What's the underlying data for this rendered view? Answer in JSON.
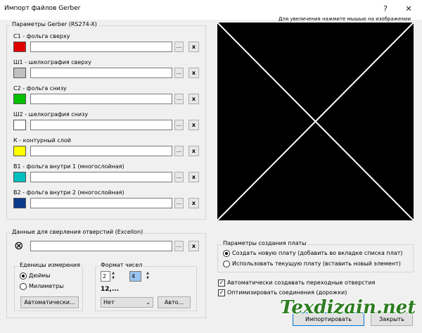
{
  "window": {
    "title": "Импорт файлов Gerber",
    "help_btn": "?",
    "close_btn": "✕"
  },
  "gerber": {
    "group_label": "Параметры Gerber (RS274-X)",
    "browse_label": "...",
    "clear_label": "x",
    "layers": [
      {
        "label": "С1 - фольга сверху",
        "color": "#e00000",
        "value": ""
      },
      {
        "label": "Ш1 - шелкография сверху",
        "color": "#c0c0c0",
        "value": ""
      },
      {
        "label": "С2 - фольга снизу",
        "color": "#00c000",
        "value": ""
      },
      {
        "label": "Ш2 - шелкография снизу",
        "color": "#ffffff",
        "value": ""
      },
      {
        "label": "К - контурный слой",
        "color": "#ffff00",
        "value": ""
      },
      {
        "label": "В1 - фольга внутри 1 (многослойная)",
        "color": "#00bfbf",
        "value": ""
      },
      {
        "label": "В2 - фольга внутри 2 (многослойная)",
        "color": "#0a3a8c",
        "value": ""
      }
    ]
  },
  "preview": {
    "hint": "Для увеличения нажмите мышью на изображении"
  },
  "excellon": {
    "group_label": "Данные для сверления отверстий (Excellon)",
    "drill_icon_glyph": "⊗",
    "value": "",
    "browse_label": "...",
    "clear_label": "x",
    "units": {
      "label": "Еденицы измерения",
      "options": [
        {
          "label": "Дюймы",
          "selected": true
        },
        {
          "label": "Милиметры",
          "selected": false
        }
      ],
      "auto_button": "Автоматически..."
    },
    "format": {
      "label": "Формат чисел",
      "int_digits": "2",
      "dec_digits": "4",
      "sample": "12,...",
      "zeros_option": "Нет",
      "auto_button": "Авто..."
    }
  },
  "board": {
    "group_label": "Параметры создания платы",
    "options": [
      {
        "label": "Создать новую плату (добавить во вкладке списка плат)",
        "selected": true
      },
      {
        "label": "Использовать текущую плату (вставить новый элемент)",
        "selected": false
      }
    ]
  },
  "checks": [
    {
      "label": "Автоматически создавать переходные отверстия",
      "checked": true
    },
    {
      "label": "Оптимизировать соединения (дорожки)",
      "checked": true
    }
  ],
  "buttons": {
    "import": "Импортировать",
    "close": "Закрыть"
  },
  "watermark": "Texdizain.net"
}
